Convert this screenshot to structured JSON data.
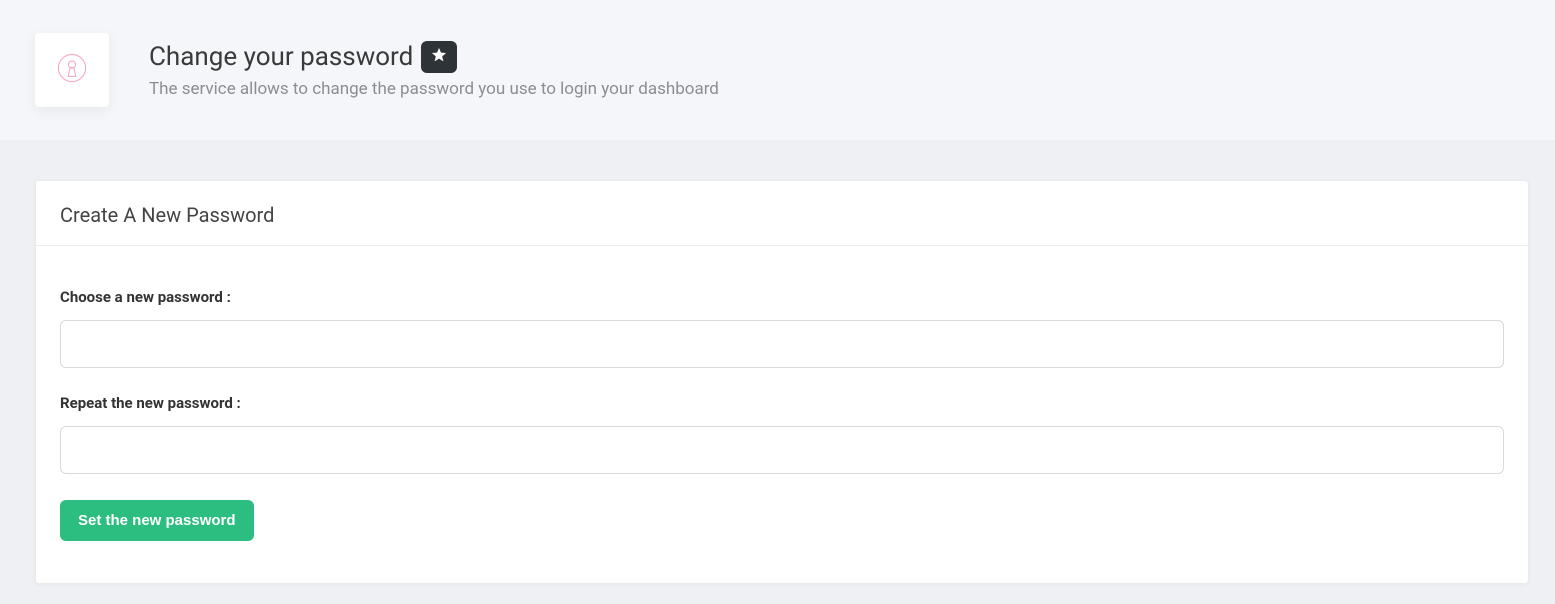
{
  "header": {
    "title": "Change your password",
    "subtitle": "The service allows to change the password you use to login your dashboard"
  },
  "card": {
    "title": "Create A New Password"
  },
  "form": {
    "newPasswordLabel": "Choose a new password :",
    "repeatPasswordLabel": "Repeat the new password :",
    "newPasswordValue": "",
    "repeatPasswordValue": "",
    "submitLabel": "Set the new password"
  },
  "colors": {
    "accent": "#2bbe80",
    "headerBg": "#f5f6f9",
    "pageBg": "#eef0f4",
    "keyholeStroke": "#f4a9c6",
    "starBadgeBg": "#2e3338"
  }
}
